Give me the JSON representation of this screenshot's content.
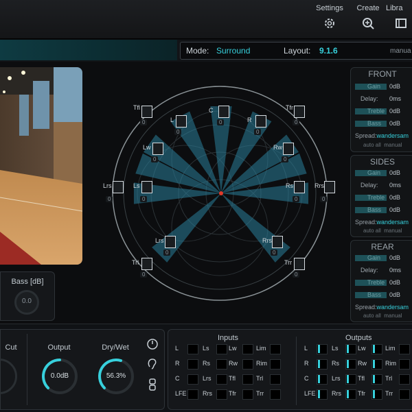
{
  "toolbar": {
    "settings_label": "Settings",
    "create_label": "Create",
    "library_label": "Libra"
  },
  "mode": {
    "mode_label": "Mode:",
    "mode_value": "Surround",
    "layout_label": "Layout:",
    "layout_value": "9.1.6",
    "manual_label": "manua"
  },
  "bass": {
    "label": "Bass [dB]",
    "value": "0.0"
  },
  "speakers": {
    "TfL": "Tfl",
    "C": "C",
    "TfR": "Tfr",
    "L": "L",
    "R": "R",
    "Lw": "Lw",
    "Rw": "Rw",
    "Lrs_left": "Lrs",
    "Ls": "Ls",
    "Rs": "Rs",
    "Rrs": "Rrs",
    "Lrs": "Lrs",
    "Rrs2": "Rrs",
    "Trl": "Trl",
    "Trr": "Trr",
    "val": "0"
  },
  "panels": {
    "front": {
      "title": "FRONT",
      "gain": "Gain",
      "gain_val": "0dB",
      "delay": "Delay:",
      "delay_val": "0ms",
      "treble": "Treble",
      "treble_val": "0dB",
      "bass": "Bass",
      "bass_val": "0dB",
      "spread": "Spread:",
      "spread_val": "wandersam",
      "auto": "auto all",
      "manual": "manual"
    },
    "sides": {
      "title": "SIDES",
      "gain": "Gain",
      "gain_val": "0dB",
      "delay": "Delay:",
      "delay_val": "0ms",
      "treble": "Treble",
      "treble_val": "0dB",
      "bass": "Bass",
      "bass_val": "0dB",
      "spread": "Spread:",
      "spread_val": "wandersam",
      "auto": "auto all",
      "manual": "manual"
    },
    "rear": {
      "title": "REAR",
      "gain": "Gain",
      "gain_val": "0dB",
      "delay": "Delay:",
      "delay_val": "0ms",
      "treble": "Treble",
      "treble_val": "0dB",
      "bass": "Bass",
      "bass_val": "0dB",
      "spread": "Spread:",
      "spread_val": "wandersam",
      "auto": "auto all",
      "manual": "manual"
    }
  },
  "output": {
    "cut_label": "Cut",
    "output_label": "Output",
    "output_value": "0.0dB",
    "drywet_label": "Dry/Wet",
    "drywet_value": "56.3%",
    "drywet_fraction": 0.563,
    "output_fraction": 0.5
  },
  "io": {
    "inputs_title": "Inputs",
    "outputs_title": "Outputs",
    "inputs": [
      [
        "L",
        "Ls",
        "Lw",
        "Lim"
      ],
      [
        "R",
        "Rs",
        "Rw",
        "Rim"
      ],
      [
        "C",
        "Lrs",
        "Tfl",
        "Trl"
      ],
      [
        "LFE",
        "Rrs",
        "Tfr",
        "Trr"
      ]
    ],
    "outputs": [
      [
        "L",
        "Ls",
        "Lw",
        "Lim"
      ],
      [
        "R",
        "Rs",
        "Rw",
        "Rim"
      ],
      [
        "C",
        "Lrs",
        "Tfl",
        "Trl"
      ],
      [
        "LFE",
        "Rrs",
        "Tfr",
        "Trr"
      ]
    ]
  }
}
